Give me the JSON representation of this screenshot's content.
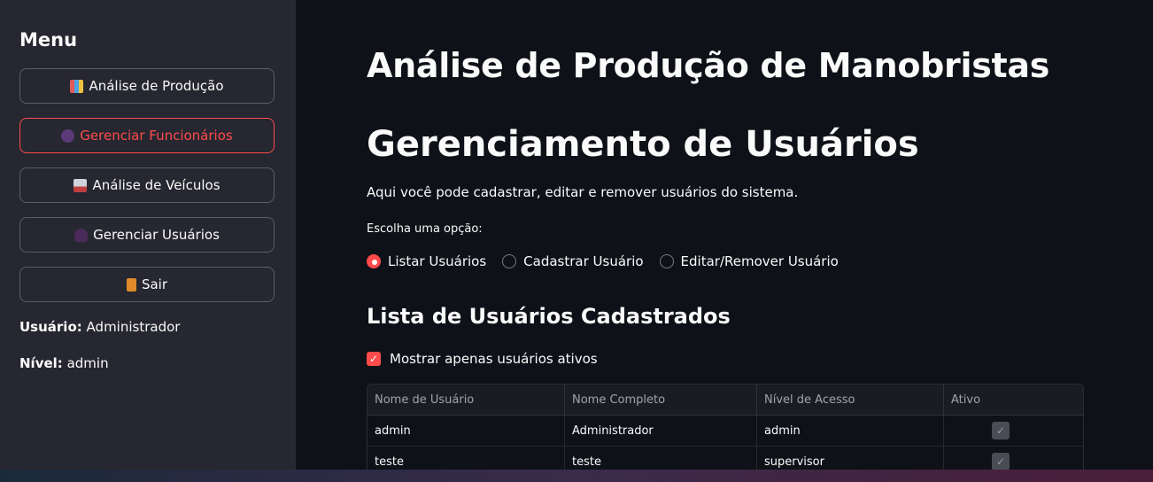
{
  "sidebar": {
    "title": "Menu",
    "buttons": [
      {
        "label": "Análise de Produção",
        "icon": "bar-chart-icon"
      },
      {
        "label": "Gerenciar Funcionários",
        "icon": "people-icon"
      },
      {
        "label": "Análise de Veículos",
        "icon": "truck-icon"
      },
      {
        "label": "Gerenciar Usuários",
        "icon": "user-icon"
      },
      {
        "label": "Sair",
        "icon": "door-icon"
      }
    ],
    "user_label": "Usuário:",
    "user_value": "Administrador",
    "level_label": "Nível:",
    "level_value": "admin"
  },
  "main": {
    "title": "Análise de Produção de Manobristas",
    "section_title": "Gerenciamento de Usuários",
    "description": "Aqui você pode cadastrar, editar e remover usuários do sistema.",
    "radio_label": "Escolha uma opção:",
    "radio_options": [
      "Listar Usuários",
      "Cadastrar Usuário",
      "Editar/Remover Usuário"
    ],
    "list_title": "Lista de Usuários Cadastrados",
    "checkbox_label": "Mostrar apenas usuários ativos",
    "table": {
      "headers": [
        "Nome de Usuário",
        "Nome Completo",
        "Nível de Acesso",
        "Ativo"
      ],
      "rows": [
        [
          "admin",
          "Administrador",
          "admin"
        ],
        [
          "teste",
          "teste",
          "supervisor"
        ]
      ]
    }
  },
  "colors": {
    "accent": "#ff4b4b",
    "sidebar_bg": "#262730",
    "main_bg": "#0e1117"
  }
}
